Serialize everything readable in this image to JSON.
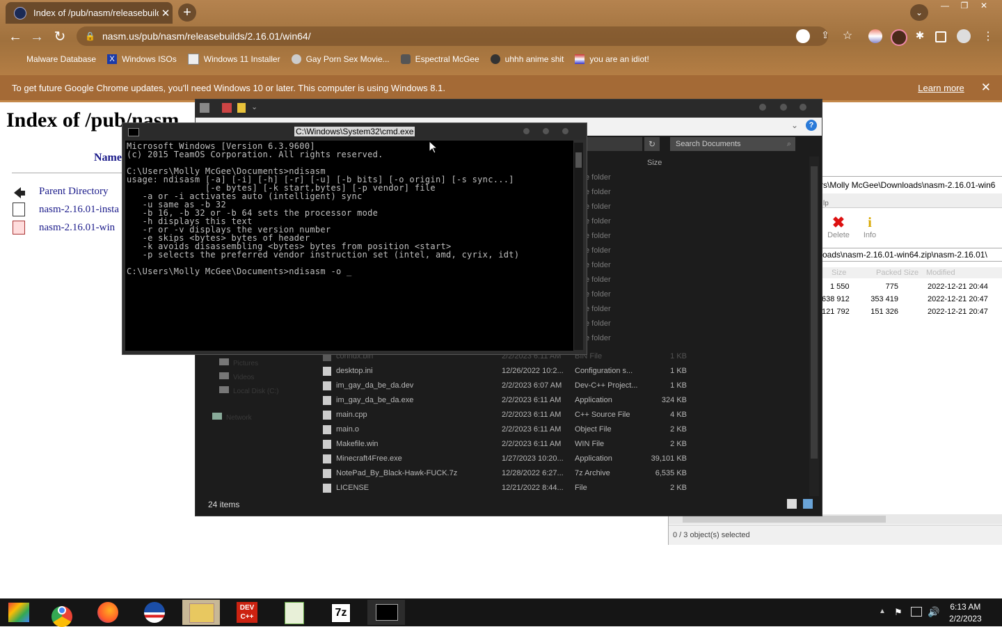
{
  "browser": {
    "tab_title": "Index of /pub/nasm/releasebuild",
    "url": "nasm.us/pub/nasm/releasebuilds/2.16.01/win64/",
    "bookmarks": [
      "Malware Database",
      "Windows ISOs",
      "Windows 11 Installer",
      "Gay Porn Sex Movie...",
      "Espectral McGee",
      "uhhh anime shit",
      "you are an idiot!"
    ],
    "infobar_message": "To get future Google Chrome updates, you'll need Windows 10 or later. This computer is using Windows 8.1.",
    "infobar_link": "Learn more"
  },
  "page": {
    "heading": "Index of /pub/nasm",
    "name_header": "Name",
    "links": [
      "Parent Directory",
      "nasm-2.16.01-insta",
      "nasm-2.16.01-win"
    ]
  },
  "explorer": {
    "search_placeholder": "Search Documents",
    "size_header": "Size",
    "folder_label": "e folder",
    "folder_rows": 12,
    "sidebar": [
      "Pictures",
      "Videos",
      "Local Disk (C:)",
      "Network"
    ],
    "files": [
      {
        "name": "conndx.bin",
        "date": "2/2/2023 6:11 AM",
        "type": "BIN File",
        "size": "1 KB"
      },
      {
        "name": "desktop.ini",
        "date": "12/26/2022 10:2...",
        "type": "Configuration s...",
        "size": "1 KB"
      },
      {
        "name": "im_gay_da_be_da.dev",
        "date": "2/2/2023 6:07 AM",
        "type": "Dev-C++ Project...",
        "size": "1 KB"
      },
      {
        "name": "im_gay_da_be_da.exe",
        "date": "2/2/2023 6:11 AM",
        "type": "Application",
        "size": "324 KB"
      },
      {
        "name": "main.cpp",
        "date": "2/2/2023 6:11 AM",
        "type": "C++ Source File",
        "size": "4 KB"
      },
      {
        "name": "main.o",
        "date": "2/2/2023 6:11 AM",
        "type": "Object File",
        "size": "2 KB"
      },
      {
        "name": "Makefile.win",
        "date": "2/2/2023 6:11 AM",
        "type": "WIN File",
        "size": "2 KB"
      },
      {
        "name": "Minecraft4Free.exe",
        "date": "1/27/2023 10:20...",
        "type": "Application",
        "size": "39,101 KB"
      },
      {
        "name": "NotePad_By_Black-Hawk-FUCK.7z",
        "date": "12/28/2022 6:27...",
        "type": "7z Archive",
        "size": "6,535 KB"
      },
      {
        "name": "LICENSE",
        "date": "12/21/2022 8:44...",
        "type": "File",
        "size": "2 KB"
      }
    ],
    "status": "24 items"
  },
  "sevenzip": {
    "path": "rs\\Molly McGee\\Downloads\\nasm-2.16.01-win6",
    "menu": "lp",
    "delete_label": "Delete",
    "info_label": "Info",
    "archive_path": "oads\\nasm-2.16.01-win64.zip\\nasm-2.16.01\\",
    "col_size": "Size",
    "col_packed": "Packed Size",
    "col_modified": "Modified",
    "rows": [
      {
        "size": "1 550",
        "packed": "775",
        "modified": "2022-12-21 20:44"
      },
      {
        "size": "638 912",
        "packed": "353 419",
        "modified": "2022-12-21 20:47"
      },
      {
        "size": "121 792",
        "packed": "151 326",
        "modified": "2022-12-21 20:47"
      }
    ],
    "status": "0 / 3 object(s) selected"
  },
  "cmd": {
    "title": "C:\\Windows\\System32\\cmd.exe",
    "output": "Microsoft Windows [Version 6.3.9600]\n(c) 2015 TeamOS Corporation. All rights reserved.\n\nC:\\Users\\Molly McGee\\Documents>ndisasm\nusage: ndisasm [-a] [-i] [-h] [-r] [-u] [-b bits] [-o origin] [-s sync...]\n               [-e bytes] [-k start,bytes] [-p vendor] file\n   -a or -i activates auto (intelligent) sync\n   -u same as -b 32\n   -b 16, -b 32 or -b 64 sets the processor mode\n   -h displays this text\n   -r or -v displays the version number\n   -e skips <bytes> bytes of header\n   -k avoids disassembling <bytes> bytes from position <start>\n   -p selects the preferred vendor instruction set (intel, amd, cyrix, idt)\n\nC:\\Users\\Molly McGee\\Documents>ndisasm -o _"
  },
  "taskbar": {
    "apps": [
      "google-icon",
      "chrome-icon",
      "firefox-icon",
      "obama-icon",
      "explorer-icon",
      "devcpp-icon",
      "notepadpp-icon",
      "7zip-icon",
      "cmd-icon"
    ],
    "devcpp_label": "DEV C++",
    "sevenzip_label": "7z",
    "time": "6:13 AM",
    "date": "2/2/2023"
  }
}
